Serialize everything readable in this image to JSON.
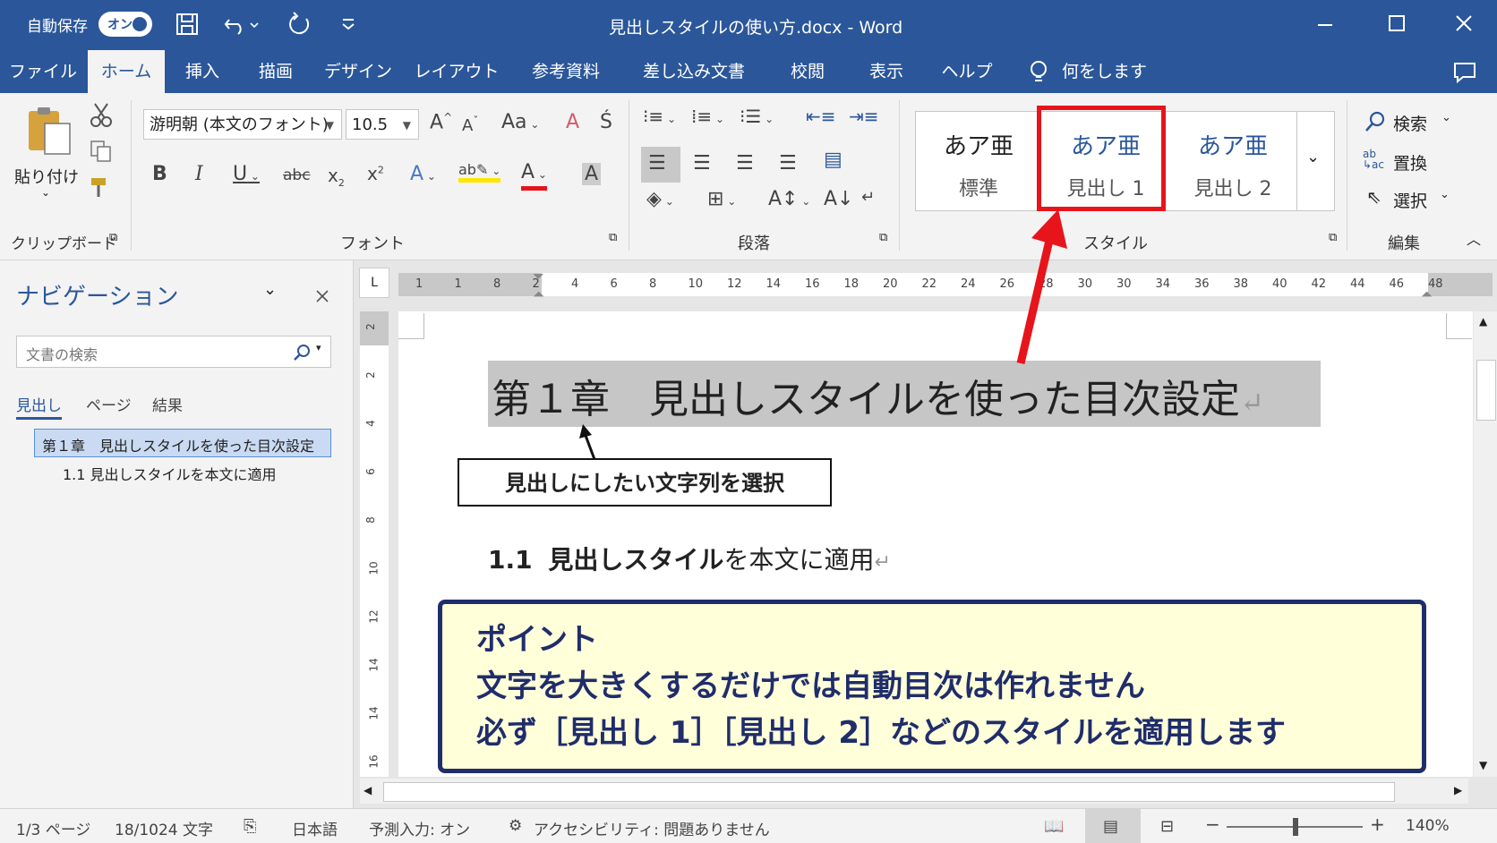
{
  "titlebar": {
    "autosave_label": "自動保存",
    "autosave_state": "オン",
    "doc_title": "見出しスタイルの使い方.docx  -  Word"
  },
  "tabs": [
    "ファイル",
    "ホーム",
    "挿入",
    "描画",
    "デザイン",
    "レイアウト",
    "参考資料",
    "差し込み文書",
    "校閲",
    "表示",
    "ヘルプ"
  ],
  "active_tab": "ホーム",
  "tell_me": "何をしますか",
  "ribbon": {
    "clipboard": {
      "paste": "貼り付け",
      "group": "クリップボード"
    },
    "font": {
      "name": "游明朝 (本文のフォント)",
      "size": "10.5",
      "group": "フォント"
    },
    "paragraph": {
      "group": "段落"
    },
    "styles": {
      "group": "スタイル",
      "items": [
        {
          "sample": "あア亜",
          "name": "標準"
        },
        {
          "sample": "あア亜",
          "name": "見出し 1"
        },
        {
          "sample": "あア亜",
          "name": "見出し 2"
        }
      ]
    },
    "editing": {
      "find": "検索",
      "replace": "置換",
      "select": "選択",
      "group": "編集"
    }
  },
  "navigation": {
    "title": "ナビゲーション",
    "search_placeholder": "文書の検索",
    "tabs": [
      "見出し",
      "ページ",
      "結果"
    ],
    "items": [
      {
        "text": "第１章　見出しスタイルを使った目次設定",
        "level": 1
      },
      {
        "text": "1.1 見出しスタイルを本文に適用",
        "level": 2
      }
    ]
  },
  "ruler": {
    "h_ticks": [
      "1",
      "1",
      "8",
      "2",
      "4",
      "6",
      "8",
      "10",
      "12",
      "14",
      "16",
      "18",
      "20",
      "22",
      "24",
      "26",
      "28",
      "30",
      "30",
      "34",
      "36",
      "38",
      "40",
      "42",
      "44",
      "46",
      "48"
    ],
    "v_ticks": [
      "2",
      "2",
      "4",
      "6",
      "8",
      "10",
      "12",
      "14",
      "14",
      "16"
    ]
  },
  "document": {
    "heading1": "第１章　見出しスタイルを使った目次設定",
    "callout": "見出しにしたい文字列を選択",
    "heading2_num": "1.1",
    "heading2_text_a": "見出しスタイル",
    "heading2_text_b": "を本文に適用",
    "point_lines": [
      "ポイント",
      "文字を大きくするだけでは自動目次は作れません",
      "必ず［見出し 1］［見出し 2］などのスタイルを適用します"
    ]
  },
  "statusbar": {
    "page": "1/3 ページ",
    "words": "18/1024 文字",
    "lang": "日本語",
    "predict": "予測入力: オン",
    "access": "アクセシビリティ: 問題ありません",
    "zoom": "140%"
  },
  "colors": {
    "word_blue": "#2b579a",
    "highlight_red": "#e8141b",
    "point_bg": "#ffffd9",
    "point_border": "#1f2d6b"
  }
}
